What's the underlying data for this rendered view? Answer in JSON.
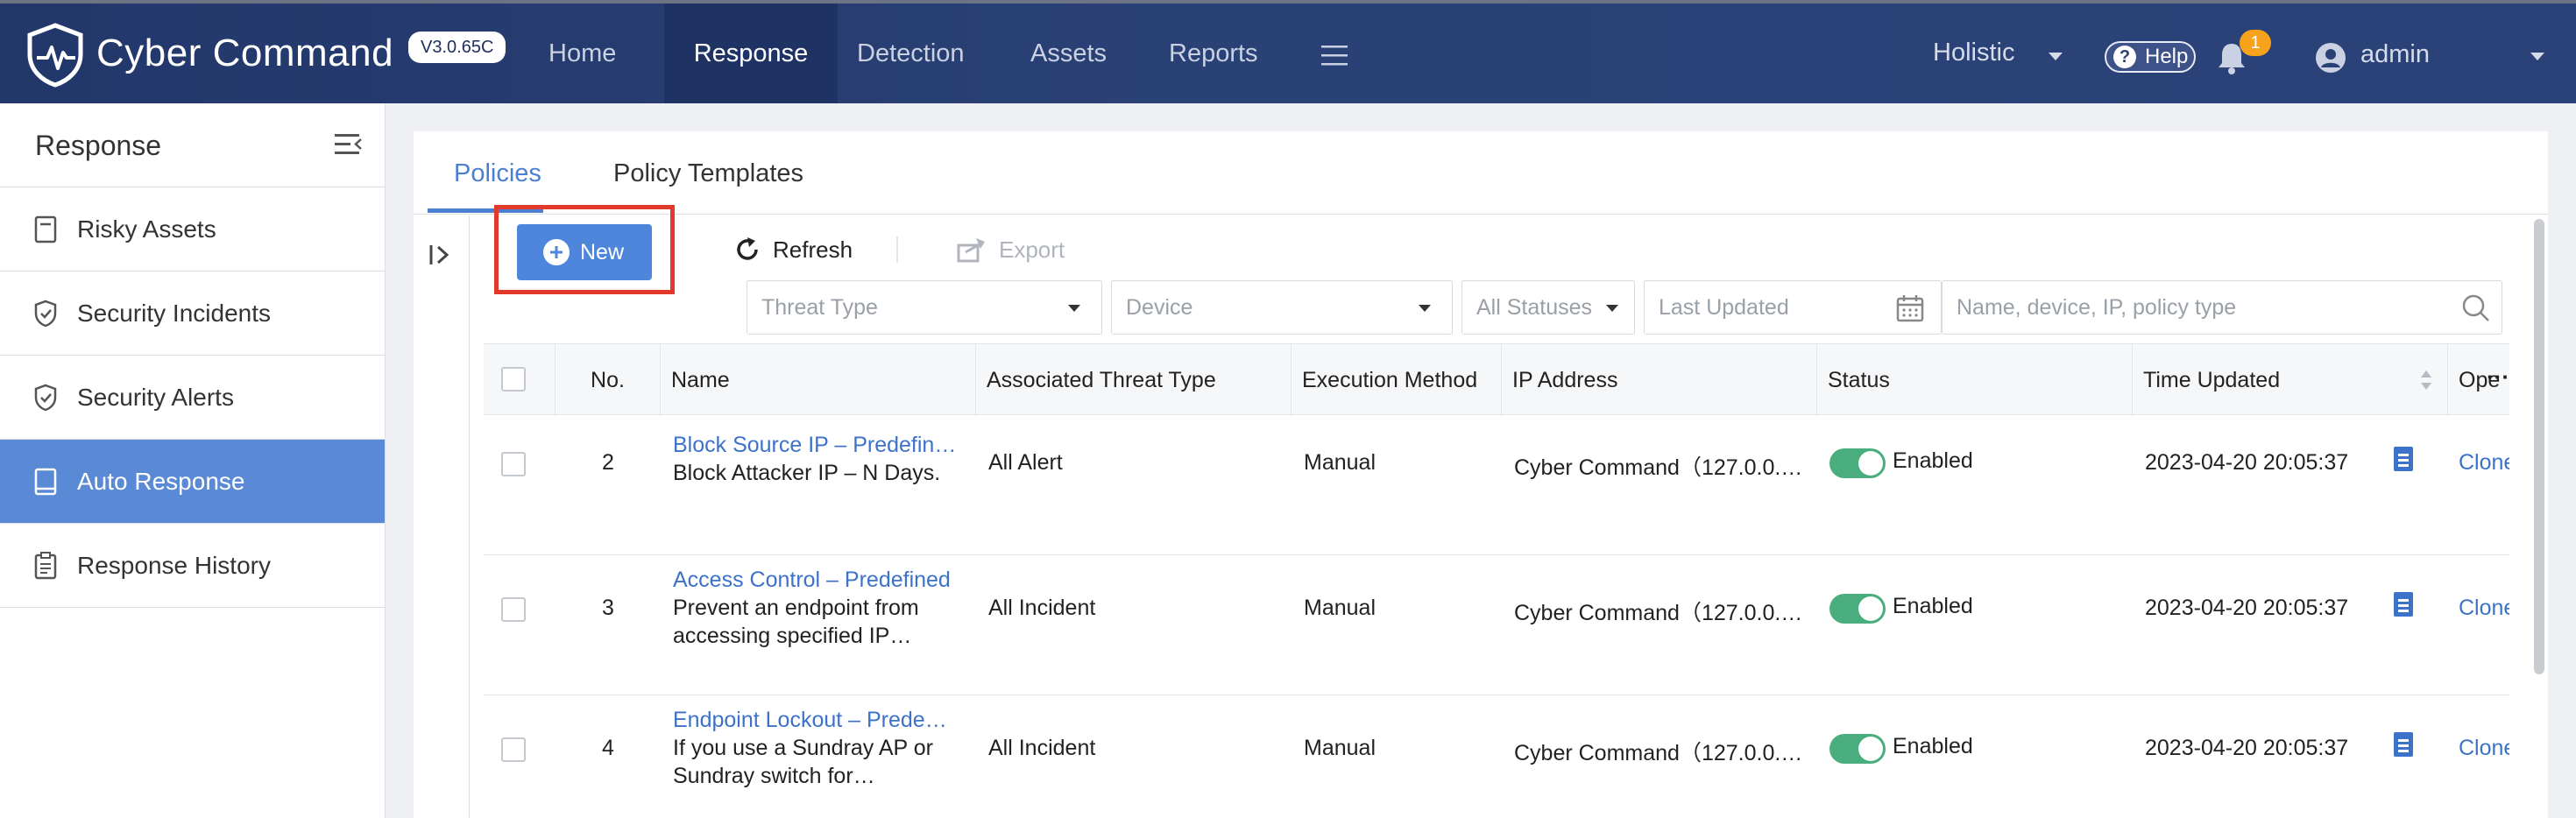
{
  "app": {
    "name": "Cyber Command",
    "version": "V3.0.65C"
  },
  "nav": {
    "items": [
      "Home",
      "Response",
      "Detection",
      "Assets",
      "Reports"
    ],
    "active": "Response",
    "scope": "Holistic",
    "help_label": "Help",
    "notification_count": "1",
    "user": "admin"
  },
  "sidebar": {
    "title": "Response",
    "items": [
      {
        "label": "Risky Assets",
        "icon": "document-icon"
      },
      {
        "label": "Security Incidents",
        "icon": "shield-icon"
      },
      {
        "label": "Security Alerts",
        "icon": "shield-icon"
      },
      {
        "label": "Auto Response",
        "icon": "book-icon",
        "active": true
      },
      {
        "label": "Response History",
        "icon": "clipboard-icon"
      }
    ]
  },
  "tabs": [
    "Policies",
    "Policy Templates"
  ],
  "toolbar": {
    "new_label": "New",
    "refresh_label": "Refresh",
    "export_label": "Export"
  },
  "filters": {
    "threat_type": "Threat Type",
    "device": "Device",
    "status": "All Statuses",
    "last_updated": "Last Updated",
    "search_placeholder": "Name, device, IP, policy type"
  },
  "table": {
    "headers": [
      "No.",
      "Name",
      "Associated Threat Type",
      "Execution Method",
      "IP Address",
      "Status",
      "Time Updated",
      "Ope"
    ],
    "more_label": "···",
    "rows": [
      {
        "no": "2",
        "name": "Block Source IP – Predefin…",
        "desc1": "Block Attacker IP – N Days.",
        "desc2": "",
        "threat": "All Alert",
        "method": "Manual",
        "ip": "Cyber Command（127.0.0.…",
        "status": "Enabled",
        "time": "2023-04-20 20:05:37",
        "op": "Clone"
      },
      {
        "no": "3",
        "name": "Access Control – Predefined",
        "desc1": "Prevent an endpoint from",
        "desc2": "accessing specified IP…",
        "threat": "All Incident",
        "method": "Manual",
        "ip": "Cyber Command（127.0.0.…",
        "status": "Enabled",
        "time": "2023-04-20 20:05:37",
        "op": "Clone"
      },
      {
        "no": "4",
        "name": "Endpoint Lockout – Prede…",
        "desc1": "If you use a Sundray AP or",
        "desc2": "Sundray switch for…",
        "threat": "All Incident",
        "method": "Manual",
        "ip": "Cyber Command（127.0.0.…",
        "status": "Enabled",
        "time": "2023-04-20 20:05:37",
        "op": "Clone"
      }
    ]
  },
  "colors": {
    "topbar": "#2a4176",
    "accent": "#4e86db",
    "active_sidebar": "#5a8ad6",
    "toggle_on": "#49ad7e",
    "highlight": "#e3392b",
    "badge": "#f7a21b"
  }
}
